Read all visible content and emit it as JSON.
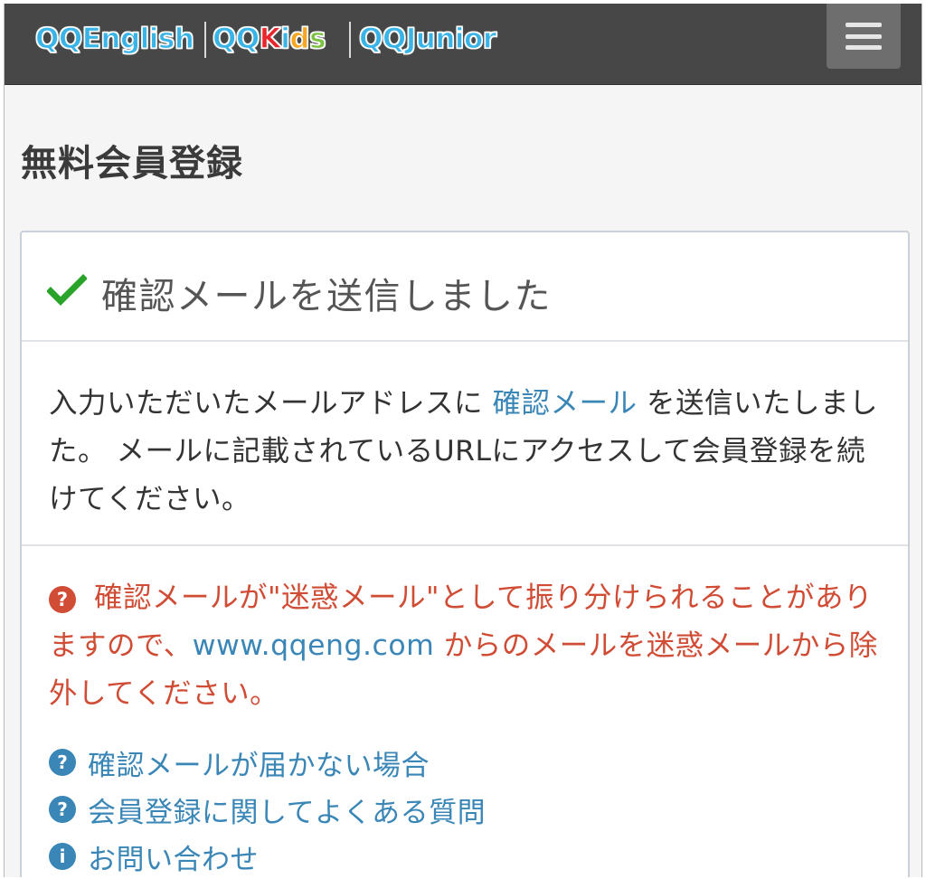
{
  "header": {
    "brands": [
      {
        "qq": "QQ",
        "word": "English",
        "word_color": "#3ab4e6"
      },
      {
        "qq": "QQ",
        "letters": [
          {
            "ch": "K",
            "color": "#e8262b"
          },
          {
            "ch": "i",
            "color": "#3ab4e6"
          },
          {
            "ch": "d",
            "color": "#f6a623"
          },
          {
            "ch": "s",
            "color": "#7cc242"
          }
        ]
      },
      {
        "qq": "QQ",
        "word": "Junior",
        "word_color": "#3ab4e6"
      }
    ],
    "menu_icon": "hamburger-icon"
  },
  "page_title": "無料会員登録",
  "panel": {
    "heading": "確認メールを送信しました",
    "heading_icon": "check-icon",
    "body": {
      "before_link": "入力いただいたメールアドレスに ",
      "link": "確認メール",
      "after_link": " を送信いたしました。 メールに記載されているURLにアクセスして会員登録を続けてください。"
    },
    "warning": {
      "icon": "question-circle-icon",
      "before_domain": "確認メールが\"迷惑メール\"として振り分けられることがありますので、",
      "domain": "www.qqeng.com",
      "after_domain": " からのメールを迷惑メールから除外してください。"
    },
    "links": [
      {
        "icon": "question-circle-icon",
        "glyph": "?",
        "label": "確認メールが届かない場合"
      },
      {
        "icon": "question-circle-icon",
        "glyph": "?",
        "label": "会員登録に関してよくある質問"
      },
      {
        "icon": "info-circle-icon",
        "glyph": "i",
        "label": "お問い合わせ"
      }
    ]
  },
  "colors": {
    "header_bg": "#474747",
    "link": "#3a86b7",
    "warning": "#d04c35",
    "check": "#2aa32a"
  }
}
